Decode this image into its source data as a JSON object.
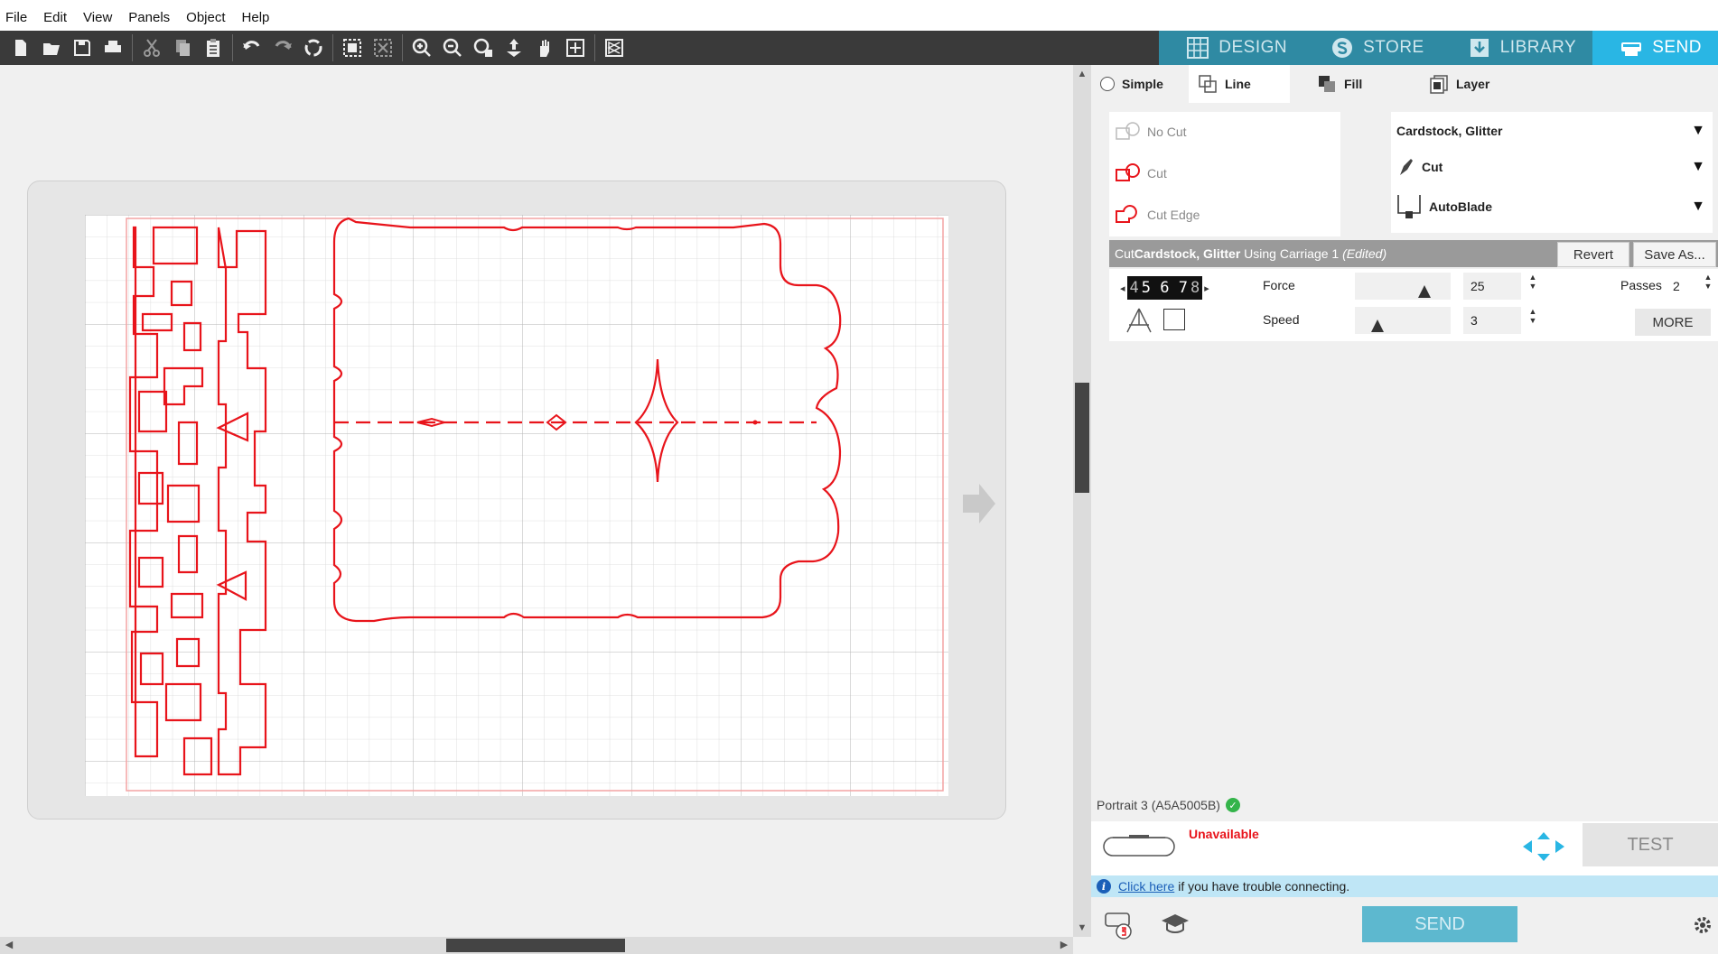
{
  "menu": [
    "File",
    "Edit",
    "View",
    "Panels",
    "Object",
    "Help"
  ],
  "nav_tabs": [
    {
      "label": "DESIGN",
      "icon": "design-grid-icon"
    },
    {
      "label": "STORE",
      "icon": "store-s-icon"
    },
    {
      "label": "LIBRARY",
      "icon": "library-icon"
    },
    {
      "label": "SEND",
      "icon": "send-cutter-icon",
      "active": true
    }
  ],
  "tools": [
    "new-file-icon",
    "open-folder-icon",
    "save-icon",
    "print-icon",
    "cut-icon",
    "copy-icon",
    "paste-icon",
    "undo-icon",
    "redo-icon",
    "redraw-icon",
    "select-all-icon",
    "deselect-icon",
    "zoom-in-icon",
    "zoom-out-icon",
    "zoom-box-icon",
    "fit-to-page-icon",
    "pan-icon",
    "zoom-fit-icon",
    "trace-icon"
  ],
  "panel": {
    "tabs": {
      "simple": "Simple",
      "line": "Line",
      "fill": "Fill",
      "layer": "Layer"
    },
    "cut_options": {
      "no_cut": "No Cut",
      "cut": "Cut",
      "cut_edge": "Cut Edge"
    },
    "material": "Cardstock, Glitter",
    "action": "Cut",
    "tool": "AutoBlade",
    "cut_bar": {
      "prefix": "Cut ",
      "material": "Cardstock, Glitter",
      "middle": " Using Carriage 1 ",
      "status": "(Edited)"
    },
    "revert_label": "Revert",
    "save_as_label": "Save As...",
    "blade_digits": {
      "left": "4",
      "main": "5 6 7",
      "right": "8"
    },
    "force_label": "Force",
    "force_value": "25",
    "speed_label": "Speed",
    "speed_value": "3",
    "passes_label": "Passes",
    "passes_value": "2",
    "more_label": "MORE",
    "device_name": "Portrait 3 (A5A5005B)",
    "device_status": "Unavailable",
    "test_label": "TEST",
    "info_link": "Click here",
    "info_text": "if you have trouble connecting.",
    "send_label": "SEND"
  },
  "colors": {
    "accent": "#29b6e4",
    "cut_line": "#e8141b",
    "toolbar": "#3a3a3a"
  }
}
